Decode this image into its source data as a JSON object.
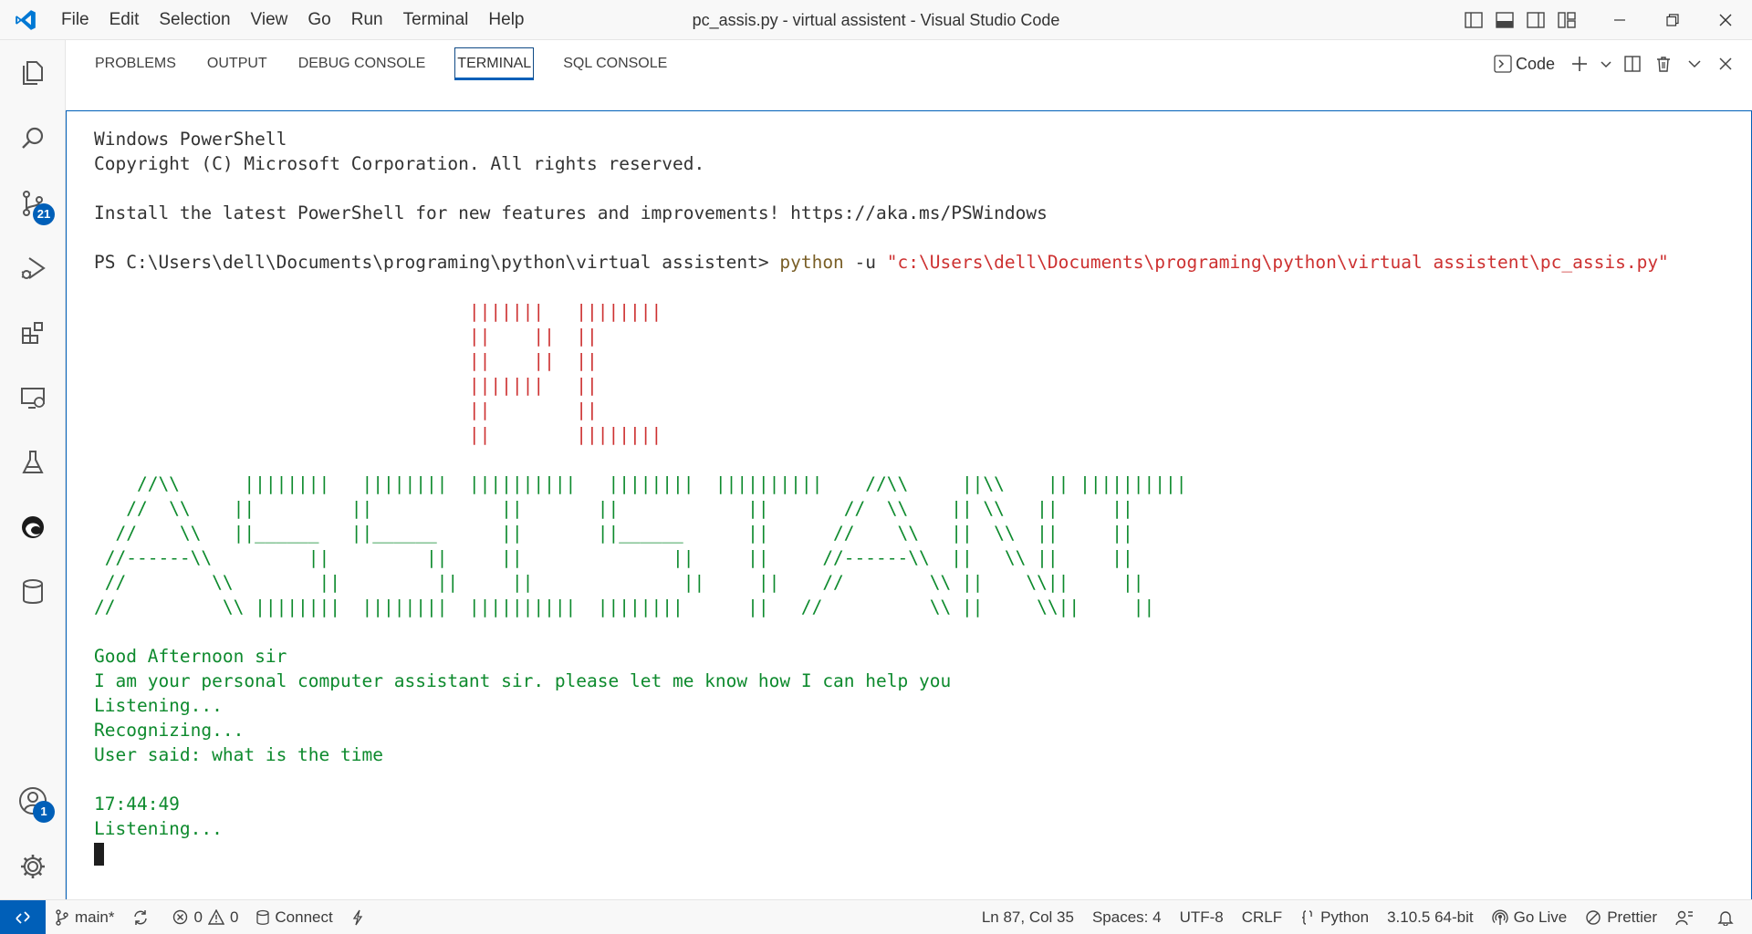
{
  "titlebar": {
    "title": "pc_assis.py - virtual assistent - Visual Studio Code",
    "menu": [
      "File",
      "Edit",
      "Selection",
      "View",
      "Go",
      "Run",
      "Terminal",
      "Help"
    ]
  },
  "activity": {
    "source_control_badge": "21",
    "accounts_badge": "1"
  },
  "panel": {
    "tabs": [
      "PROBLEMS",
      "OUTPUT",
      "DEBUG CONSOLE",
      "TERMINAL",
      "SQL CONSOLE"
    ],
    "active_tab": "TERMINAL",
    "terminal_name": "Code"
  },
  "terminal": {
    "lines": {
      "l1": "Windows PowerShell",
      "l2": "Copyright (C) Microsoft Corporation. All rights reserved.",
      "l3": "Install the latest PowerShell for new features and improvements! https://aka.ms/PSWindows",
      "prompt": "PS C:\\Users\\dell\\Documents\\programing\\python\\virtual assistent> ",
      "cmd": "python",
      "flag": " -u ",
      "path": "\"c:\\Users\\dell\\Documents\\programing\\python\\virtual assistent\\pc_assis.py\""
    },
    "art_pc": [
      "                                   |||||||   ||||||||",
      "                                   ||    ||  ||",
      "                                   ||    ||  ||",
      "                                   |||||||   ||",
      "                                   ||        ||",
      "                                   ||        ||||||||"
    ],
    "art_assistant": [
      "    //\\\\      ||||||||   ||||||||  ||||||||||   ||||||||  ||||||||||    //\\\\     ||\\\\    || ||||||||||",
      "   //  \\\\    ||         ||            ||       ||            ||       //  \\\\    || \\\\   ||     ||",
      "  //    \\\\   ||______   ||______      ||       ||______      ||      //    \\\\   ||  \\\\  ||     ||",
      " //------\\\\         ||         ||     ||              ||     ||     //------\\\\  ||   \\\\ ||     ||",
      " //        \\\\        ||         ||     ||              ||     ||    //        \\\\ ||    \\\\||     ||",
      "//          \\\\ ||||||||  ||||||||  ||||||||||  ||||||||      ||   //          \\\\ ||     \\\\||     ||"
    ],
    "output": {
      "o1": "Good Afternoon sir",
      "o2": "I am your personal computer assistant sir. please let me know how I can help you",
      "o3": "Listening...",
      "o4": "Recognizing...",
      "o5": "User said: what is the time",
      "o6": "17:44:49",
      "o7": "Listening..."
    }
  },
  "statusbar": {
    "branch": "main*",
    "errors": "0",
    "warnings": "0",
    "connect": "Connect",
    "position": "Ln 87, Col 35",
    "spaces": "Spaces: 4",
    "encoding": "UTF-8",
    "eol": "CRLF",
    "language": "Python",
    "interpreter": "3.10.5 64-bit",
    "golive": "Go Live",
    "prettier": "Prettier"
  },
  "colors": {
    "accent": "#005fb8",
    "terminal_green": "#0d8a2d",
    "terminal_red": "#cd3131"
  }
}
